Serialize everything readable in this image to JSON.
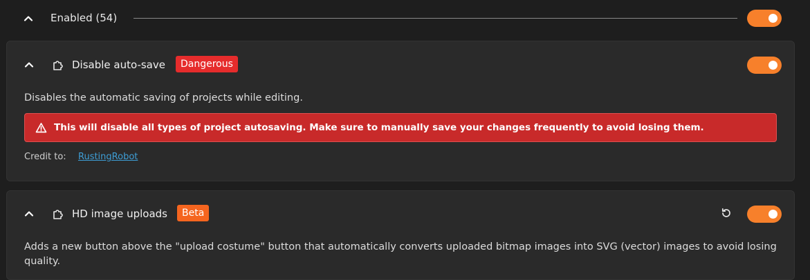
{
  "section": {
    "title": "Enabled (54)",
    "enabled": true
  },
  "addons": [
    {
      "title": "Disable auto-save",
      "badge": "Dangerous",
      "badge_color": "#e62c2c",
      "enabled": true,
      "description": "Disables the automatic saving of projects while editing.",
      "warning": "This will disable all types of project autosaving. Make sure to manually save your changes frequently to avoid losing them.",
      "credit_label": "Credit to:",
      "credit_name": "RustingRobot"
    },
    {
      "title": "HD image uploads",
      "badge": "Beta",
      "badge_color": "#f5651f",
      "enabled": true,
      "description": "Adds a new button above the \"upload costume\" button that automatically converts uploaded bitmap images into SVG (vector) images to avoid losing quality."
    }
  ],
  "colors": {
    "accent": "#f7802b",
    "background": "#1e1e1e",
    "card": "#2a2a2a",
    "warning": "#c82a2a",
    "link": "#3e9ed6"
  },
  "icons": [
    "chevron-up-icon",
    "puzzle-icon",
    "warning-icon",
    "reset-icon"
  ]
}
